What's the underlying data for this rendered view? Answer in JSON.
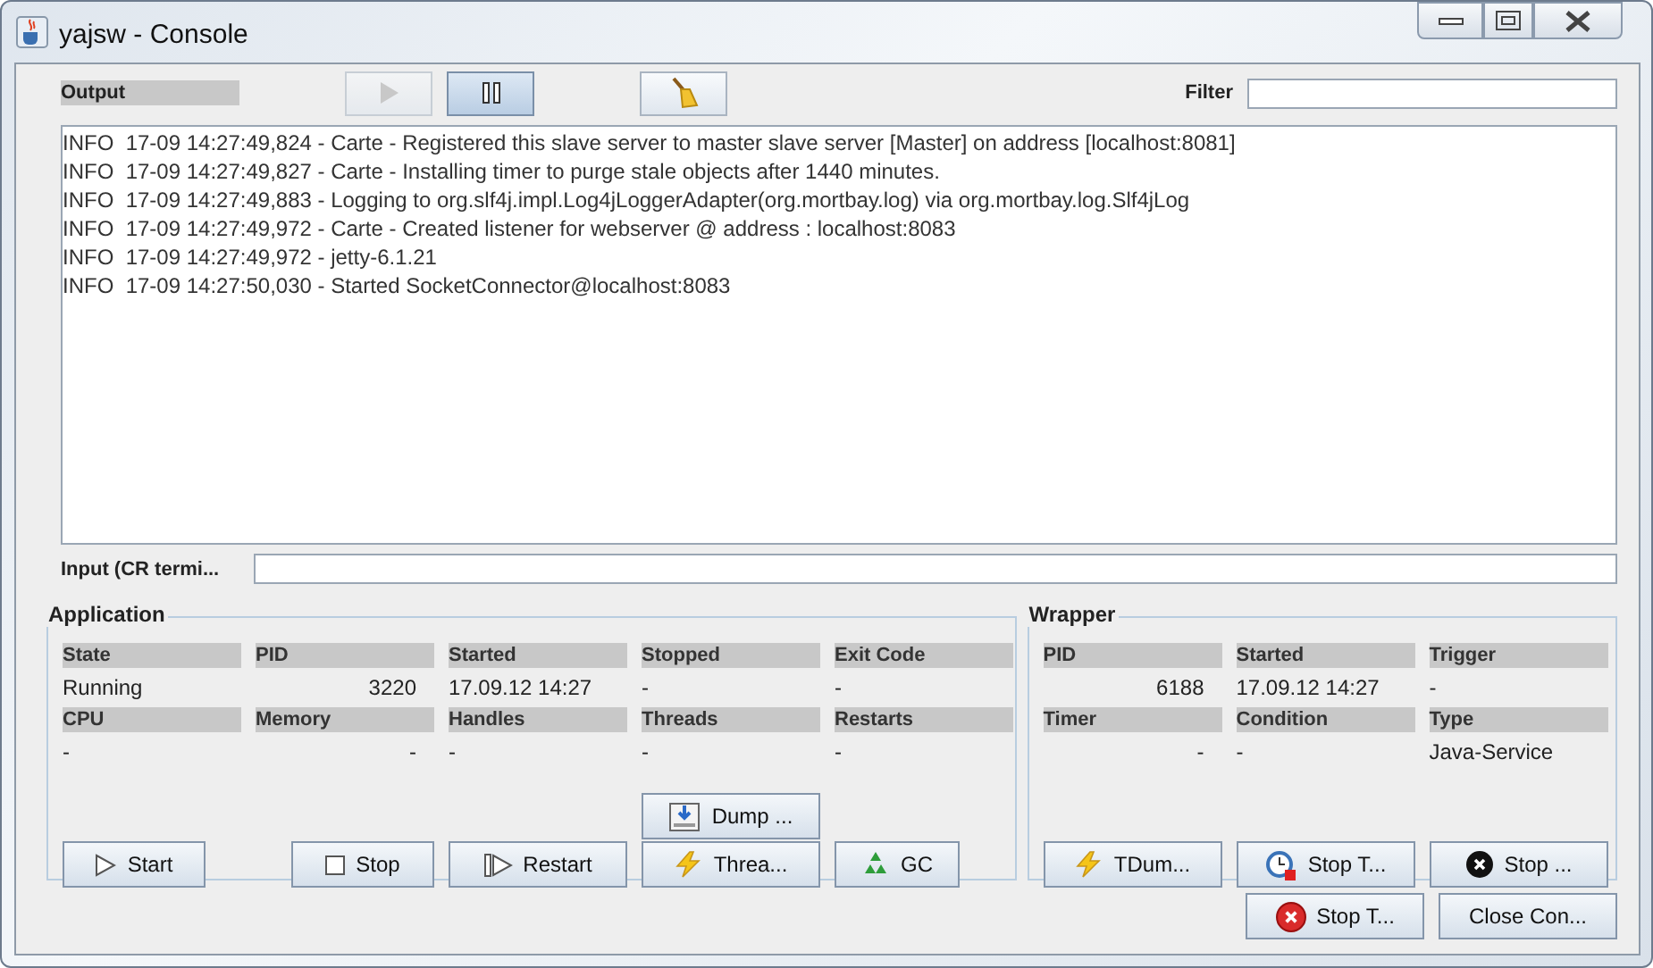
{
  "window": {
    "title": "yajsw - Console"
  },
  "output": {
    "label": "Output",
    "filter_label": "Filter",
    "toolbar": [
      {
        "kind": "play",
        "disabled": true,
        "selected": false
      },
      {
        "kind": "pause",
        "disabled": false,
        "selected": true
      },
      {
        "kind": "clear",
        "disabled": false,
        "selected": false
      }
    ],
    "lines": [
      "INFO  17-09 14:27:49,824 - Carte - Registered this slave server to master slave server [Master] on address [localhost:8081]",
      "INFO  17-09 14:27:49,827 - Carte - Installing timer to purge stale objects after 1440 minutes.",
      "INFO  17-09 14:27:49,883 - Logging to org.slf4j.impl.Log4jLoggerAdapter(org.mortbay.log) via org.mortbay.log.Slf4jLog",
      "INFO  17-09 14:27:49,972 - Carte - Created listener for webserver @ address : localhost:8083",
      "INFO  17-09 14:27:49,972 - jetty-6.1.21",
      "INFO  17-09 14:27:50,030 - Started SocketConnector@localhost:8083"
    ],
    "input_label": "Input (CR termi..."
  },
  "application": {
    "title": "Application",
    "fields": [
      {
        "label": "State",
        "value": "Running",
        "kind": "text"
      },
      {
        "label": "PID",
        "value": "3220",
        "kind": "number"
      },
      {
        "label": "Started",
        "value": "17.09.12 14:27",
        "kind": "text"
      },
      {
        "label": "Stopped",
        "value": "-",
        "kind": "text"
      },
      {
        "label": "Exit Code",
        "value": "-",
        "kind": "text"
      },
      {
        "label": "CPU",
        "value": "-",
        "kind": "text"
      },
      {
        "label": "Memory",
        "value": "-",
        "kind": "number"
      },
      {
        "label": "Handles",
        "value": "-",
        "kind": "text"
      },
      {
        "label": "Threads",
        "value": "-",
        "kind": "text"
      },
      {
        "label": "Restarts",
        "value": "-",
        "kind": "text"
      }
    ],
    "buttons": [
      {
        "label": "Dump ...",
        "kind": "dump"
      },
      {
        "label": "Start",
        "kind": "start"
      },
      {
        "label": "Stop",
        "kind": "stop"
      },
      {
        "label": "Restart",
        "kind": "restart"
      },
      {
        "label": "Threa...",
        "kind": "threads"
      },
      {
        "label": "GC",
        "kind": "gc"
      }
    ]
  },
  "wrapper": {
    "title": "Wrapper",
    "fields": [
      {
        "label": "PID",
        "value": "6188",
        "kind": "number"
      },
      {
        "label": "Started",
        "value": "17.09.12 14:27",
        "kind": "text"
      },
      {
        "label": "Trigger",
        "value": "-",
        "kind": "text"
      },
      {
        "label": "Timer",
        "value": "-",
        "kind": "number"
      },
      {
        "label": "Condition",
        "value": "-",
        "kind": "text"
      },
      {
        "label": "Type",
        "value": "Java-Service",
        "kind": "text"
      }
    ],
    "buttons": [
      {
        "label": "TDum...",
        "kind": "threads"
      },
      {
        "label": "Stop T...",
        "kind": "stop_timer"
      },
      {
        "label": "Stop ...",
        "kind": "stop_wrapper"
      }
    ]
  },
  "footer_buttons": [
    {
      "label": "Stop T...",
      "kind": "stop_tray"
    },
    {
      "label": "Close Con...",
      "kind": "close"
    }
  ]
}
